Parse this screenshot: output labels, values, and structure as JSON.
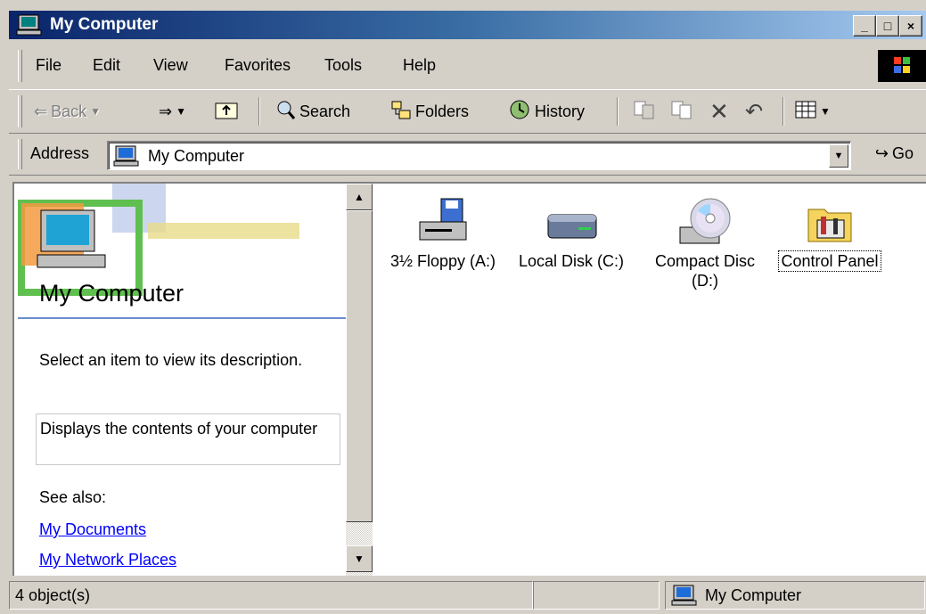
{
  "window": {
    "title": "My Computer",
    "caption_buttons": {
      "minimize": "_",
      "maximize": "□",
      "close": "×"
    }
  },
  "menu": [
    "File",
    "Edit",
    "View",
    "Favorites",
    "Tools",
    "Help"
  ],
  "toolbar": {
    "back": "Back",
    "search": "Search",
    "folders": "Folders",
    "history": "History"
  },
  "address": {
    "label": "Address",
    "value": "My Computer",
    "go": "Go"
  },
  "left_panel": {
    "title": "My Computer",
    "instruction": "Select an item to view its description.",
    "description": "Displays the contents of your computer",
    "see_also": "See also:",
    "links": [
      "My Documents",
      "My Network Places"
    ]
  },
  "items": [
    {
      "label": "3½ Floppy (A:)",
      "icon": "floppy-drive-icon"
    },
    {
      "label": "Local Disk (C:)",
      "icon": "hard-disk-icon"
    },
    {
      "label": "Compact Disc (D:)",
      "icon": "cd-drive-icon"
    },
    {
      "label": "Control Panel",
      "icon": "control-panel-icon"
    }
  ],
  "status": {
    "objects": "4 object(s)",
    "zone": "My Computer"
  },
  "colors": {
    "titlebar_start": "#0a246a",
    "titlebar_end": "#a6caf0",
    "chrome": "#d4d0c8",
    "link": "#0000ff"
  }
}
